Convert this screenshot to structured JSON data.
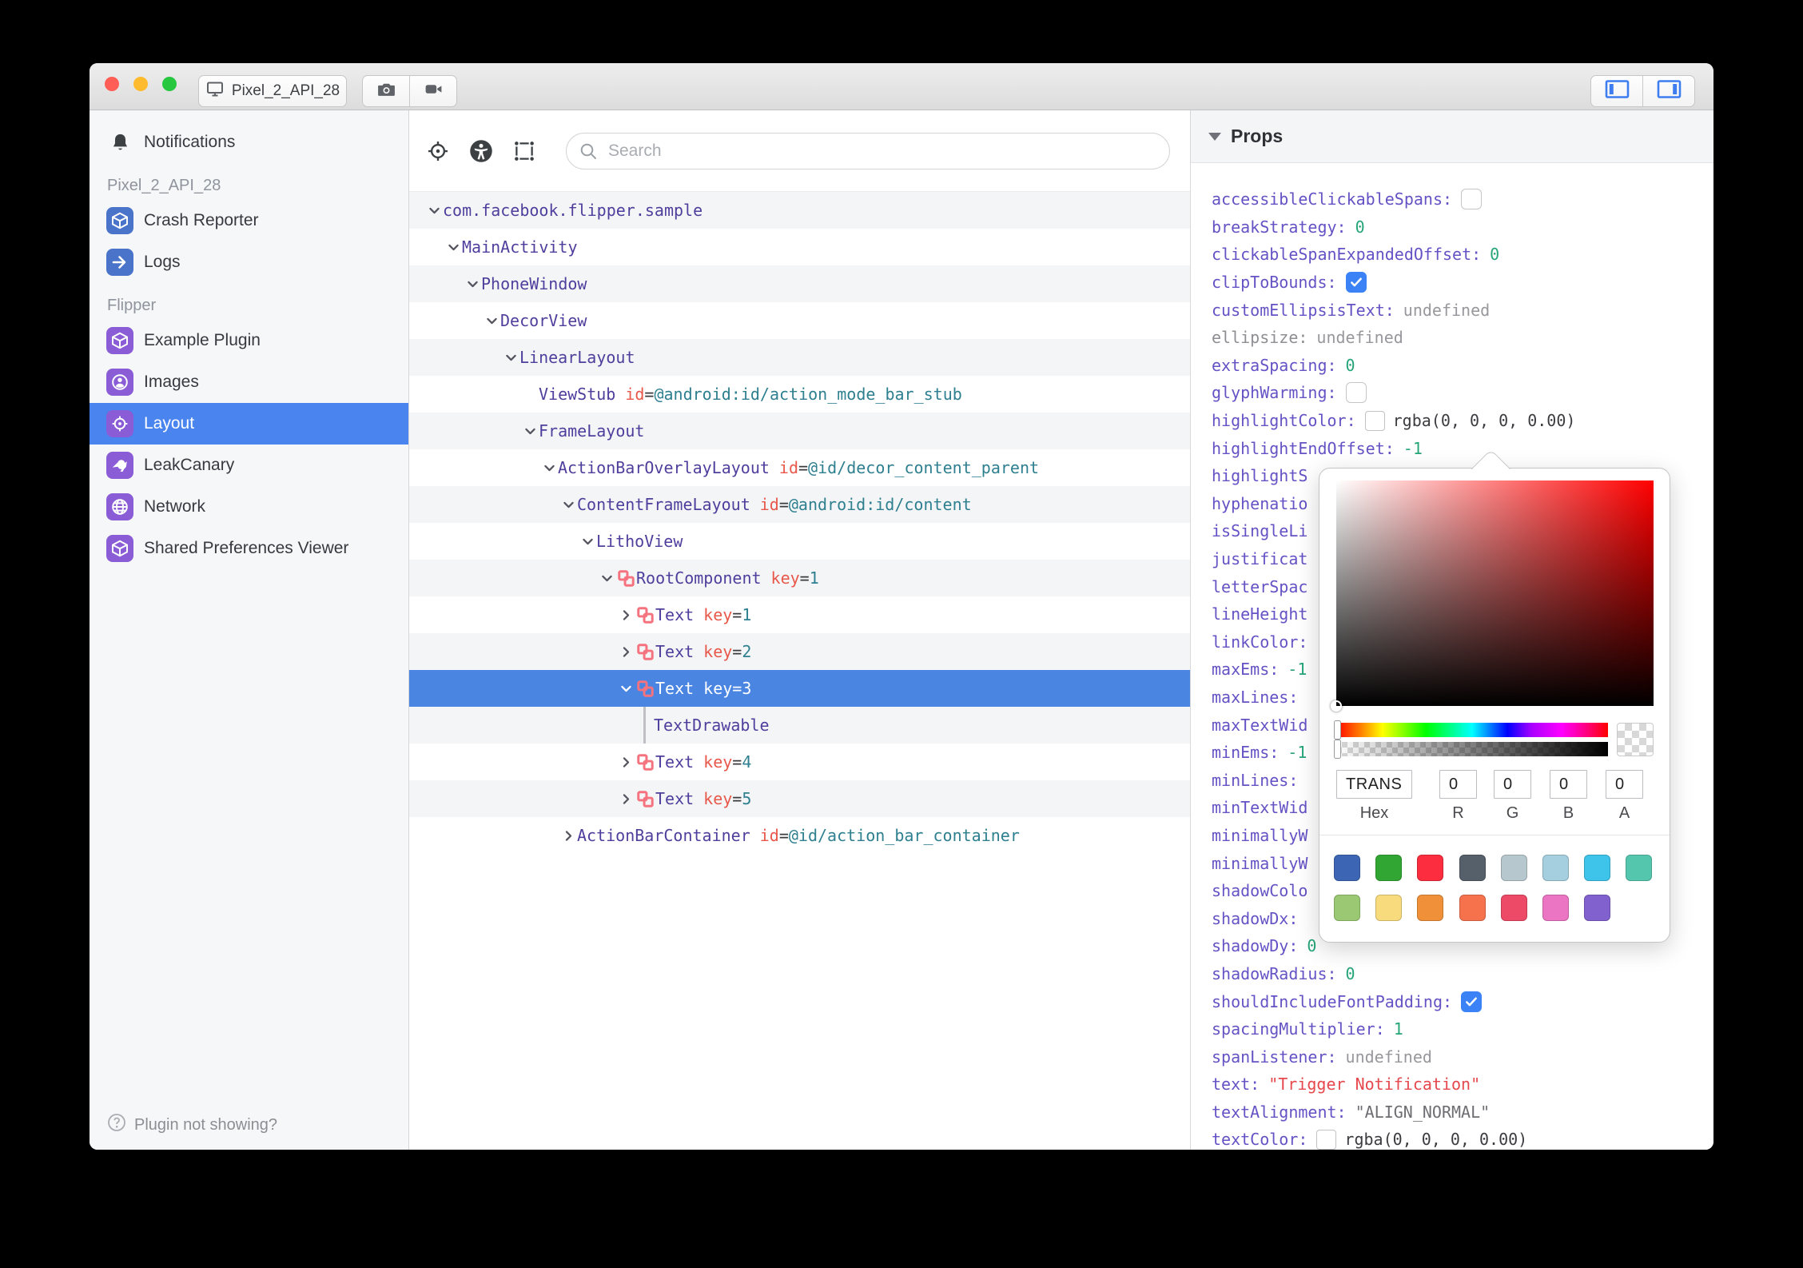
{
  "titlebar": {
    "device": "Pixel_2_API_28",
    "window_controls": [
      "close",
      "minimize",
      "zoom"
    ],
    "buttons": [
      "screenshot-camera",
      "screen-record-video",
      "toggle-left-pane",
      "toggle-right-pane"
    ]
  },
  "sidebar": {
    "items": [
      {
        "kind": "item",
        "label": "Notifications",
        "icon": "bell",
        "plain": true
      },
      {
        "kind": "section",
        "label": "Pixel_2_API_28"
      },
      {
        "kind": "item",
        "label": "Crash Reporter",
        "icon": "cube",
        "color": "#4a74c9"
      },
      {
        "kind": "item",
        "label": "Logs",
        "icon": "arrow",
        "color": "#4a74c9"
      },
      {
        "kind": "section",
        "label": "Flipper"
      },
      {
        "kind": "item",
        "label": "Example Plugin",
        "icon": "cube",
        "color": "#8a5cd6"
      },
      {
        "kind": "item",
        "label": "Images",
        "icon": "person",
        "color": "#8a5cd6"
      },
      {
        "kind": "item",
        "label": "Layout",
        "icon": "target",
        "color": "#8a5cd6",
        "selected": true
      },
      {
        "kind": "item",
        "label": "LeakCanary",
        "icon": "bird",
        "color": "#8a5cd6"
      },
      {
        "kind": "item",
        "label": "Network",
        "icon": "globe",
        "color": "#8a5cd6"
      },
      {
        "kind": "item",
        "label": "Shared Preferences Viewer",
        "icon": "cube",
        "color": "#8a5cd6"
      }
    ],
    "footer": "Plugin not showing?"
  },
  "toolbar": {
    "search_placeholder": "Search"
  },
  "tree": {
    "rows": [
      {
        "depth": 0,
        "chevron": "down",
        "name": "com.facebook.flipper.sample"
      },
      {
        "depth": 1,
        "chevron": "down",
        "name": "MainActivity"
      },
      {
        "depth": 2,
        "chevron": "down",
        "name": "PhoneWindow"
      },
      {
        "depth": 3,
        "chevron": "down",
        "name": "DecorView"
      },
      {
        "depth": 4,
        "chevron": "down",
        "name": "LinearLayout"
      },
      {
        "depth": 5,
        "chevron": "none",
        "name": "ViewStub",
        "attr_key": "id",
        "attr_value": "@android:id/action_mode_bar_stub"
      },
      {
        "depth": 5,
        "chevron": "down",
        "name": "FrameLayout"
      },
      {
        "depth": 6,
        "chevron": "down",
        "name": "ActionBarOverlayLayout",
        "attr_key": "id",
        "attr_value": "@id/decor_content_parent"
      },
      {
        "depth": 7,
        "chevron": "down",
        "name": "ContentFrameLayout",
        "attr_key": "id",
        "attr_value": "@android:id/content"
      },
      {
        "depth": 8,
        "chevron": "down",
        "name": "LithoView"
      },
      {
        "depth": 9,
        "chevron": "down",
        "litho": true,
        "name": "RootComponent",
        "attr_key": "key",
        "attr_value": "1"
      },
      {
        "depth": 10,
        "chevron": "right",
        "litho": true,
        "name": "Text",
        "attr_key": "key",
        "attr_value": "1"
      },
      {
        "depth": 10,
        "chevron": "right",
        "litho": true,
        "name": "Text",
        "attr_key": "key",
        "attr_value": "2"
      },
      {
        "depth": 10,
        "chevron": "down",
        "litho": true,
        "name": "Text",
        "attr_key": "key",
        "attr_value": "3",
        "selected": true
      },
      {
        "depth": 11,
        "chevron": "guide",
        "name": "TextDrawable"
      },
      {
        "depth": 10,
        "chevron": "right",
        "litho": true,
        "name": "Text",
        "attr_key": "key",
        "attr_value": "4"
      },
      {
        "depth": 10,
        "chevron": "right",
        "litho": true,
        "name": "Text",
        "attr_key": "key",
        "attr_value": "5"
      },
      {
        "depth": 7,
        "chevron": "right",
        "name": "ActionBarContainer",
        "attr_key": "id",
        "attr_value": "@id/action_bar_container"
      }
    ]
  },
  "props": {
    "header": "Props",
    "rows": [
      {
        "key": "accessibleClickableSpans",
        "vtype": "checkbox",
        "checked": false
      },
      {
        "key": "breakStrategy",
        "vtype": "number",
        "value": "0"
      },
      {
        "key": "clickableSpanExpandedOffset",
        "vtype": "number",
        "value": "0"
      },
      {
        "key": "clipToBounds",
        "vtype": "checkbox",
        "checked": true
      },
      {
        "key": "customEllipsisText",
        "vtype": "undefined",
        "value": "undefined"
      },
      {
        "key": "ellipsize",
        "vtype": "undefined",
        "value": "undefined",
        "gray_key": true
      },
      {
        "key": "extraSpacing",
        "vtype": "number",
        "value": "0"
      },
      {
        "key": "glyphWarming",
        "vtype": "checkbox",
        "checked": false
      },
      {
        "key": "highlightColor",
        "vtype": "color",
        "value": "rgba(0, 0, 0, 0.00)"
      },
      {
        "key": "highlightEndOffset",
        "vtype": "number",
        "value": "-1"
      },
      {
        "key": "highlightS",
        "vtype": "bare"
      },
      {
        "key": "hyphenatio",
        "vtype": "bare"
      },
      {
        "key": "isSingleLi",
        "vtype": "bare"
      },
      {
        "key": "justificat",
        "vtype": "bare"
      },
      {
        "key": "letterSpac",
        "vtype": "bare"
      },
      {
        "key": "lineHeight",
        "vtype": "bare"
      },
      {
        "key": "linkColor",
        "vtype": "colon"
      },
      {
        "key": "maxEms",
        "vtype": "number",
        "value": "-1"
      },
      {
        "key": "maxLines",
        "vtype": "colon"
      },
      {
        "key": "maxTextWid",
        "vtype": "bare"
      },
      {
        "key": "minEms",
        "vtype": "number",
        "value": "-1"
      },
      {
        "key": "minLines",
        "vtype": "colon"
      },
      {
        "key": "minTextWid",
        "vtype": "bare"
      },
      {
        "key": "minimallyW",
        "vtype": "bare"
      },
      {
        "key": "minimallyW",
        "vtype": "bare"
      },
      {
        "key": "shadowColo",
        "vtype": "bare"
      },
      {
        "key": "shadowDx",
        "vtype": "colon"
      },
      {
        "key": "shadowDy",
        "vtype": "number",
        "value": "0"
      },
      {
        "key": "shadowRadius",
        "vtype": "number",
        "value": "0"
      },
      {
        "key": "shouldIncludeFontPadding",
        "vtype": "checkbox",
        "checked": true
      },
      {
        "key": "spacingMultiplier",
        "vtype": "number",
        "value": "1"
      },
      {
        "key": "spanListener",
        "vtype": "undefined",
        "value": "undefined"
      },
      {
        "key": "text",
        "vtype": "string",
        "value": "\"Trigger Notification\""
      },
      {
        "key": "textAlignment",
        "vtype": "enum",
        "value": "\"ALIGN_NORMAL\""
      },
      {
        "key": "textColor",
        "vtype": "color",
        "value": "rgba(0, 0, 0, 0.00)"
      }
    ]
  },
  "picker": {
    "hex": "TRANS",
    "r": "0",
    "g": "0",
    "b": "0",
    "a": "0",
    "labels": {
      "hex": "Hex",
      "r": "R",
      "g": "G",
      "b": "B",
      "a": "A"
    },
    "swatches_row1": [
      "#3c66b4",
      "#32a632",
      "#fb2d3e",
      "#55606a",
      "#b7c7ce",
      "#a5cfdf",
      "#3ec4ea",
      "#55c6ae"
    ],
    "swatches_row2": [
      "#9ac873",
      "#f8db7d",
      "#f0913a",
      "#f5724d",
      "#ec4a66",
      "#eb74c3",
      "#8161ce"
    ]
  },
  "colors": {
    "selection_blue": "#4a84ee",
    "tree_name_purple": "#503e9d",
    "attr_key_red": "#e8584a",
    "attr_value_teal": "#2e7f8f",
    "prop_key_purple": "#6552c4",
    "number_green": "#26a578",
    "string_red": "#e5484d",
    "litho_pink": "#f4737e",
    "checkbox_blue": "#3b82f6"
  }
}
